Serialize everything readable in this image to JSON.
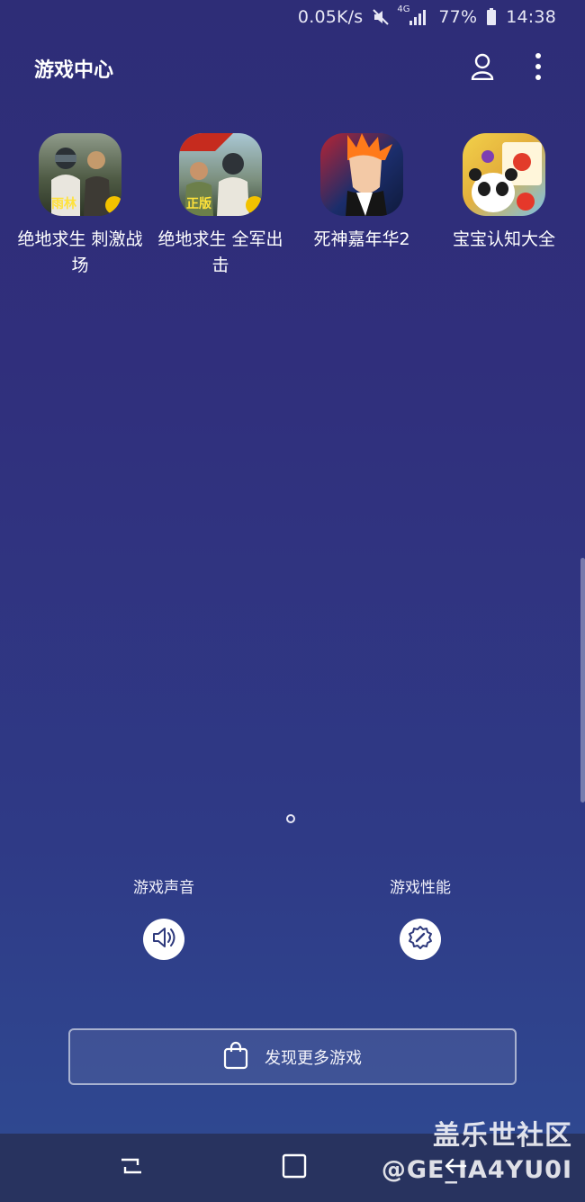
{
  "status_bar": {
    "net_speed": "0.05K/s",
    "network_type": "4G",
    "battery_percent": "77%",
    "time": "14:38",
    "icons": [
      "mute-icon",
      "signal-icon",
      "battery-icon"
    ]
  },
  "header": {
    "title": "游戏中心",
    "icons": [
      "profile-icon",
      "more-options-icon"
    ]
  },
  "games": [
    {
      "label": "绝地求生 刺激战场",
      "icon": "pubg-exhilarating-battlefield-icon",
      "badge": "雨林"
    },
    {
      "label": "绝地求生 全军出击",
      "icon": "pubg-all-out-attack-icon",
      "badge": "正版"
    },
    {
      "label": "死神嘉年华2",
      "icon": "bleach-carnival-icon"
    },
    {
      "label": "宝宝认知大全",
      "icon": "baby-cognition-icon"
    }
  ],
  "toggles": {
    "sound": {
      "label": "游戏声音",
      "icon": "speaker-icon"
    },
    "performance": {
      "label": "游戏性能",
      "icon": "performance-icon"
    }
  },
  "discover": {
    "label": "发现更多游戏",
    "icon": "shopping-bag-icon"
  },
  "watermark": {
    "line1": "盖乐世社区",
    "line2": "@GE_IA4YU0I"
  },
  "colors": {
    "bg_top": "#2e2d77",
    "bg_bottom": "#2f4b93",
    "nav_bar": "#28335f"
  }
}
